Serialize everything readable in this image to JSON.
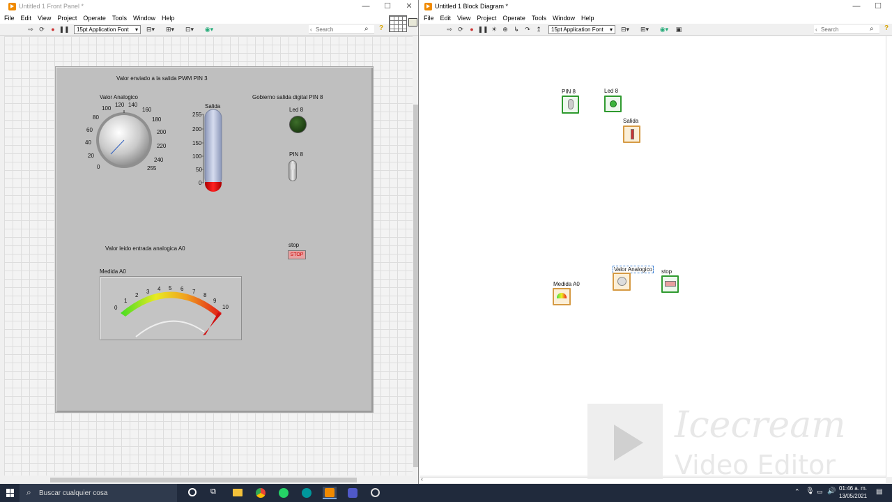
{
  "front_panel": {
    "title": "Untitled 1 Front Panel *",
    "menu": [
      "File",
      "Edit",
      "View",
      "Project",
      "Operate",
      "Tools",
      "Window",
      "Help"
    ],
    "font_select": "15pt Application Font",
    "search_placeholder": "Search",
    "labels": {
      "pwm_title": "Valor enviado a la salida PWM PIN 3",
      "knob_label": "Valor Analogico",
      "thermo_label": "Salida",
      "digital_title": "Gobierno salida digital PIN 8",
      "led_label": "Led 8",
      "switch_label": "PIN 8",
      "analog_title": "Valor leido entrada analogica A0",
      "meter_label": "Medida A0",
      "stop_label": "stop",
      "stop_button": "STOP"
    },
    "knob_ticks": [
      "0",
      "20",
      "40",
      "60",
      "80",
      "100",
      "120",
      "140",
      "160",
      "180",
      "200",
      "220",
      "240",
      "255"
    ],
    "thermo_ticks": [
      "255",
      "200",
      "150",
      "100",
      "50",
      "0"
    ],
    "meter_ticks": [
      "0",
      "1",
      "2",
      "3",
      "4",
      "5",
      "6",
      "7",
      "8",
      "9",
      "10"
    ]
  },
  "block_diagram": {
    "title": "Untitled 1 Block Diagram *",
    "menu": [
      "File",
      "Edit",
      "View",
      "Project",
      "Operate",
      "Tools",
      "Window",
      "Help"
    ],
    "font_select": "15pt Application Font",
    "search_placeholder": "Search",
    "terminals": {
      "pin8": "PIN 8",
      "led8": "Led 8",
      "salida": "Salida",
      "valor": "Valor Analogico",
      "stop": "stop",
      "medida": "Medida A0"
    }
  },
  "taskbar": {
    "search_text": "Buscar cualquier cosa",
    "time": "01:46 a. m.",
    "date": "13/05/2021"
  },
  "watermark": {
    "line1": "Icecream",
    "line2": "Video Editor"
  },
  "colors": {
    "labview_orange": "#f08a00",
    "taskbar": "#202a3c",
    "panel_gray": "#bfbfbf",
    "led_off": "#1e4a12",
    "stop_red": "#d23030"
  }
}
